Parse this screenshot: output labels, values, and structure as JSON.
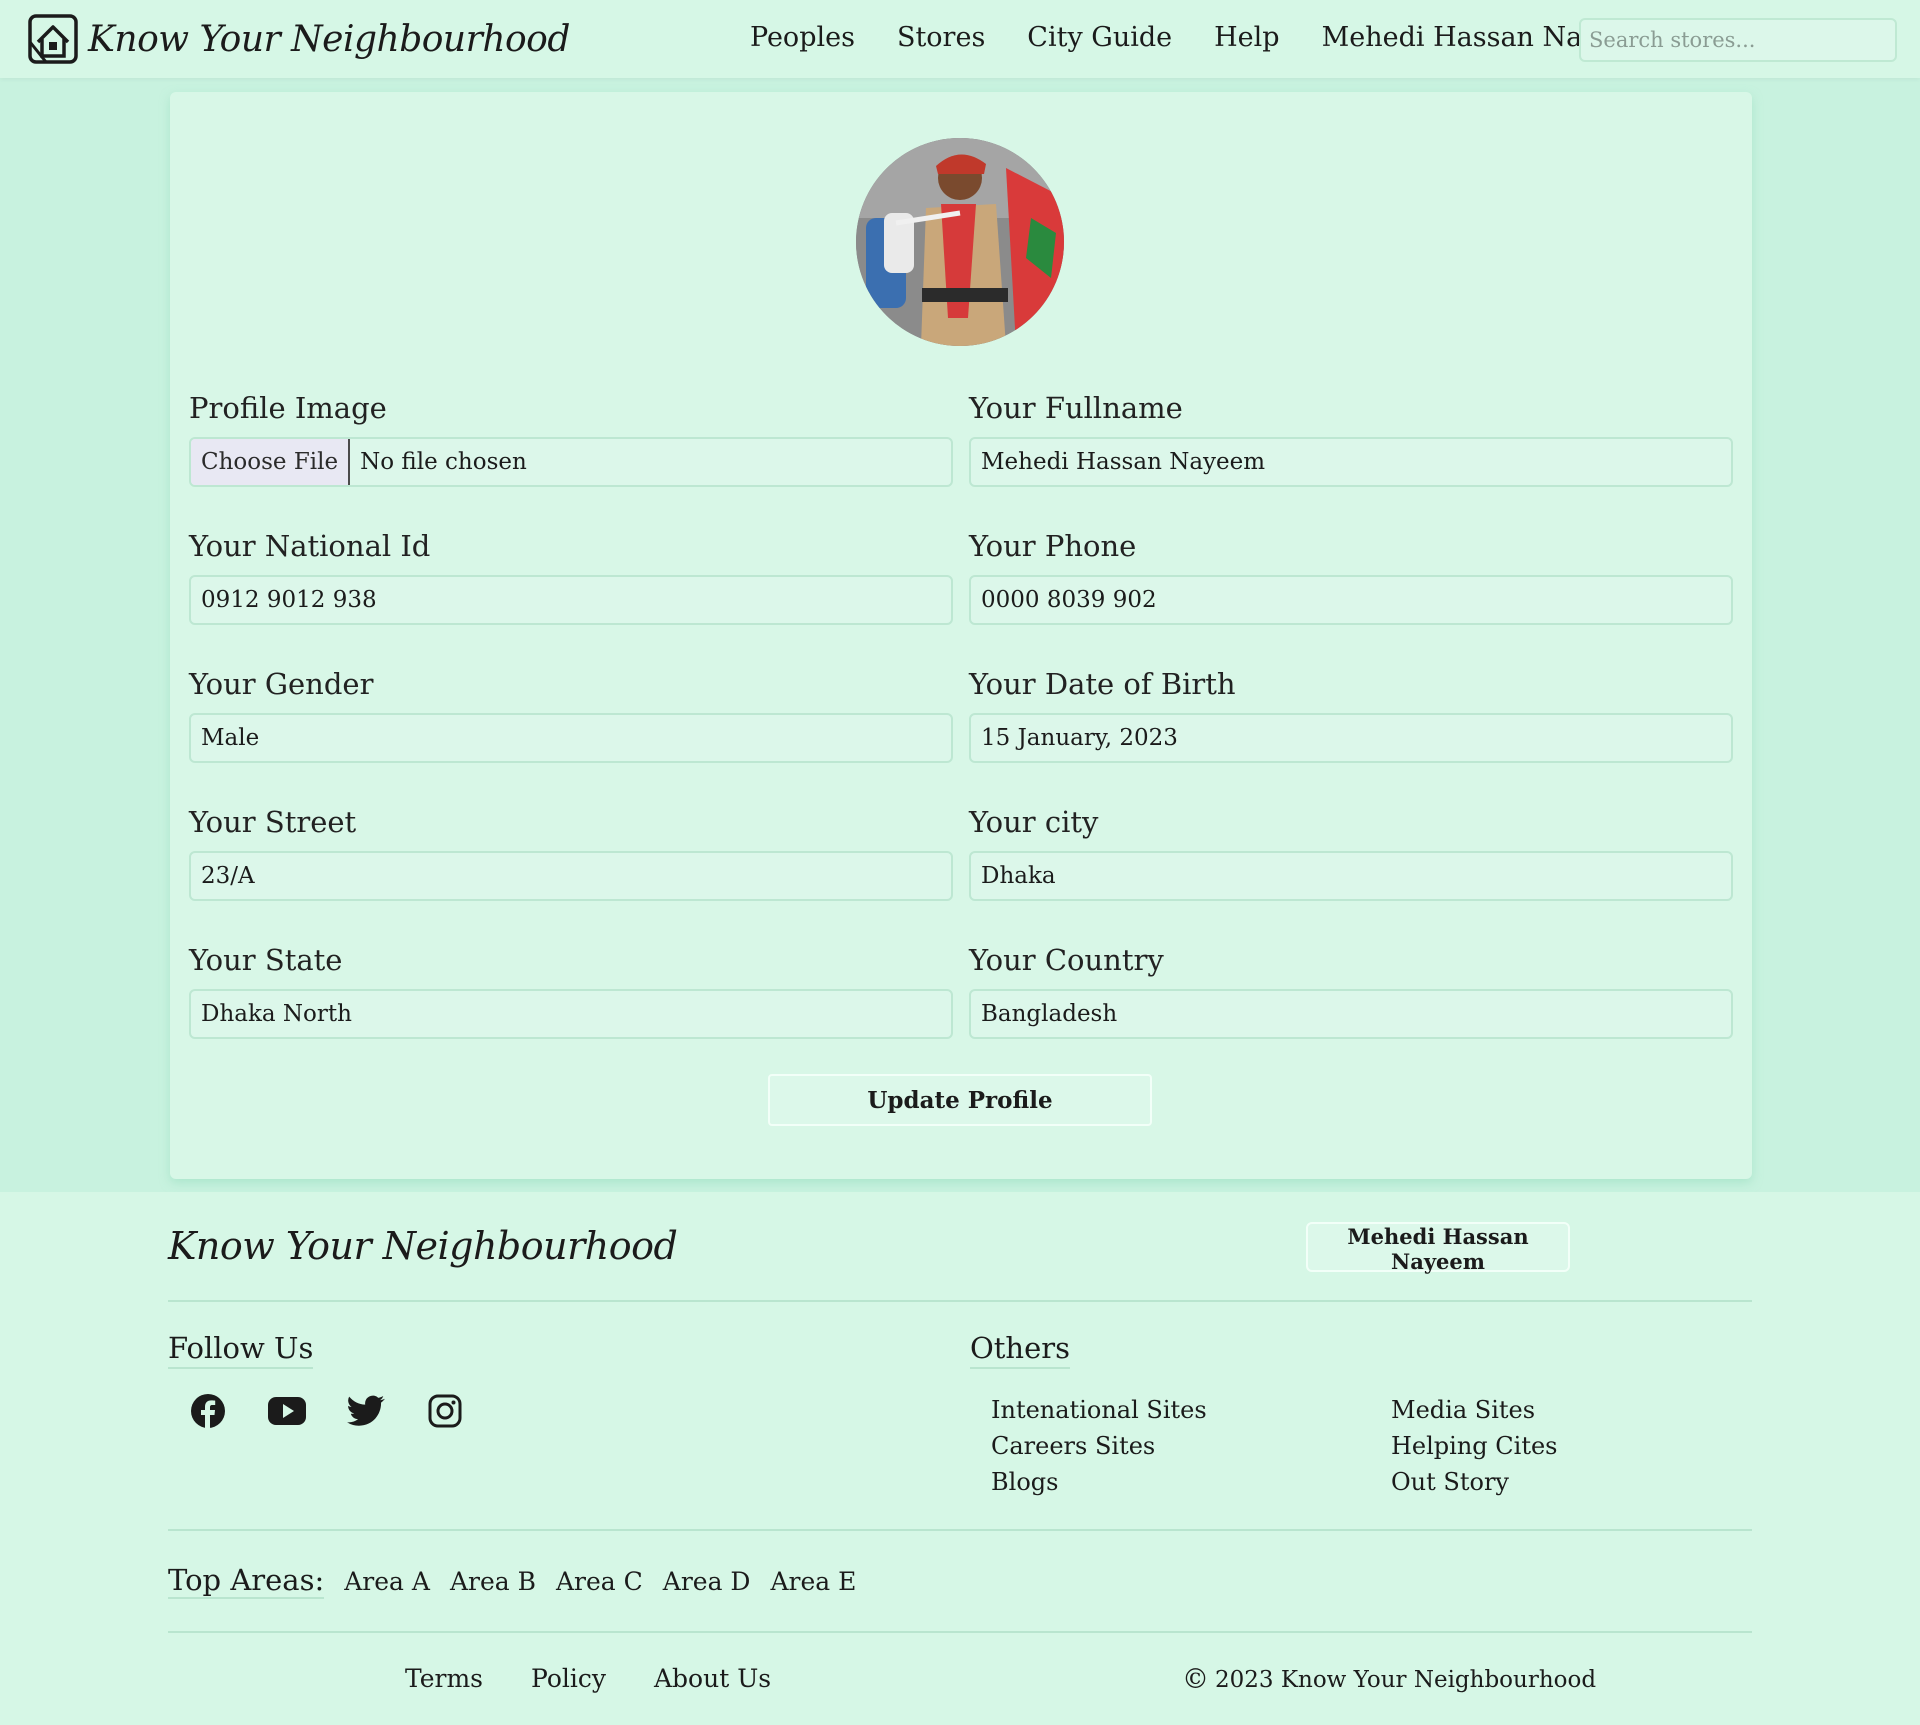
{
  "header": {
    "brand": "Know Your Neighbourhood",
    "nav": [
      "Peoples",
      "Stores",
      "City Guide",
      "Help"
    ],
    "user": "Mehedi Hassan Nayeem",
    "search_placeholder": "Search stores..."
  },
  "profile": {
    "image_label": "Profile Image",
    "file_button": "Choose File",
    "file_status": "No file chosen",
    "fullname_label": "Your Fullname",
    "fullname": "Mehedi Hassan Nayeem",
    "nid_label": "Your National Id",
    "nid": "0912 9012 938",
    "phone_label": "Your Phone",
    "phone": "0000 8039 902",
    "gender_label": "Your Gender",
    "gender": "Male",
    "dob_label": "Your Date of Birth",
    "dob": "15 January, 2023",
    "street_label": "Your Street",
    "street": "23/A",
    "city_label": "Your city",
    "city": "Dhaka",
    "state_label": "Your State",
    "state": "Dhaka North",
    "country_label": "Your Country",
    "country": "Bangladesh",
    "update_button": "Update Profile"
  },
  "footer": {
    "brand": "Know Your Neighbourhood",
    "user_button": "Mehedi Hassan Nayeem",
    "follow_heading": "Follow Us",
    "social_icons": [
      "facebook-icon",
      "youtube-icon",
      "twitter-icon",
      "instagram-icon"
    ],
    "others_heading": "Others",
    "others_col1": [
      "Intenational Sites",
      "Careers Sites",
      "Blogs"
    ],
    "others_col2": [
      "Media Sites",
      "Helping Cites",
      "Out Story"
    ],
    "top_areas_label": "Top Areas:",
    "areas": [
      "Area A",
      "Area B",
      "Area C",
      "Area D",
      "Area E"
    ],
    "bottom_links": [
      "Terms",
      "Policy",
      "About Us"
    ],
    "copyright": "2023 Know Your Neighbourhood"
  },
  "colors": {
    "page_bg": "#c8f2df",
    "card_bg": "#d8f7e7",
    "input_border": "#bde7d2"
  }
}
